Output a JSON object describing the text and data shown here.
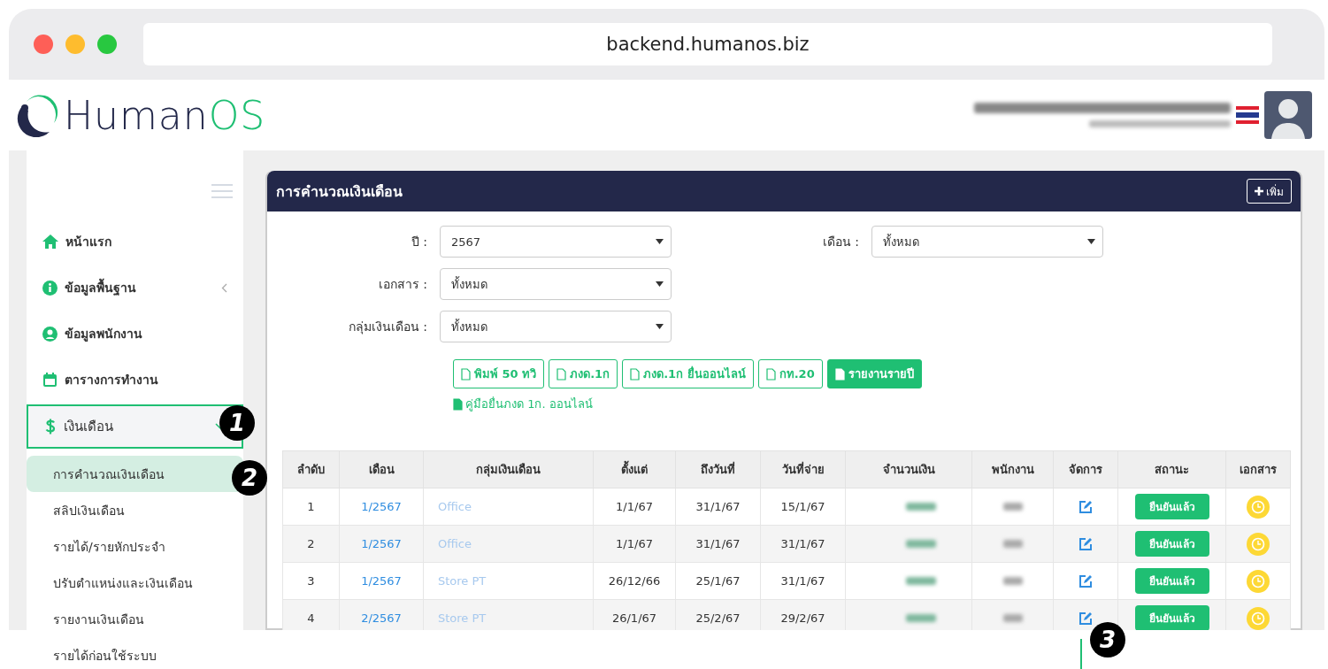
{
  "browser": {
    "address": "backend.humanos.biz"
  },
  "header": {
    "logo_dark": "Human",
    "logo_green": "OS"
  },
  "sidebar": {
    "items": [
      {
        "label": "หน้าแรก",
        "selected": false
      },
      {
        "label": "ข้อมูลพื้นฐาน",
        "selected": false,
        "expanded": false
      },
      {
        "label": "ข้อมูลพนักงาน",
        "selected": false
      },
      {
        "label": "ตารางการทำงาน",
        "selected": false
      },
      {
        "label": "เงินเดือน",
        "selected": true,
        "expanded": true,
        "children": [
          {
            "label": "การคำนวณเงินเดือน",
            "selected": true
          },
          {
            "label": "สลิปเงินเดือน",
            "selected": false
          },
          {
            "label": "รายได้/รายหักประจำ",
            "selected": false
          },
          {
            "label": "ปรับตำแหน่งและเงินเดือน",
            "selected": false
          },
          {
            "label": "รายงานเงินเดือน",
            "selected": false
          },
          {
            "label": "รายได้ก่อนใช้ระบบ",
            "selected": false
          }
        ]
      }
    ]
  },
  "panel": {
    "title": "การคำนวณเงินเดือน",
    "add_button": "เพิ่ม",
    "filters": [
      {
        "label": "ปี :",
        "value": "2567"
      },
      {
        "label": "เดือน :",
        "value": "ทั้งหมด"
      },
      {
        "label": "เอกสาร :",
        "value": "ทั้งหมด"
      },
      {
        "label": "กลุ่มเงินเดือน :",
        "value": "ทั้งหมด"
      }
    ],
    "actions": [
      {
        "label": "พิมพ์ 50 ทวิ",
        "kind": "outline"
      },
      {
        "label": "ภงด.1ก",
        "kind": "outline"
      },
      {
        "label": "ภงด.1ก ยื่นออนไลน์",
        "kind": "outline"
      },
      {
        "label": "กท.20",
        "kind": "outline"
      },
      {
        "label": "รายงานรายปี",
        "kind": "filled"
      }
    ],
    "guide_link": "คู่มือยื่นภงด 1ก. ออนไลน์",
    "table": {
      "columns": [
        "ลำดับ",
        "เดือน",
        "กลุ่มเงินเดือน",
        "ตั้งแต่",
        "ถึงวันที่",
        "วันที่จ่าย",
        "จำนวนเงิน",
        "พนักงาน",
        "จัดการ",
        "สถานะ",
        "เอกสาร"
      ],
      "rows": [
        {
          "no": "1",
          "month": "1/2567",
          "group": "Office",
          "from": "1/1/67",
          "to": "31/1/67",
          "paid": "15/1/67",
          "status": "ยืนยันแล้ว"
        },
        {
          "no": "2",
          "month": "1/2567",
          "group": "Office",
          "from": "1/1/67",
          "to": "31/1/67",
          "paid": "31/1/67",
          "status": "ยืนยันแล้ว"
        },
        {
          "no": "3",
          "month": "1/2567",
          "group": "Store PT",
          "from": "26/12/66",
          "to": "25/1/67",
          "paid": "31/1/67",
          "status": "ยืนยันแล้ว"
        },
        {
          "no": "4",
          "month": "2/2567",
          "group": "Store PT",
          "from": "26/1/67",
          "to": "25/2/67",
          "paid": "29/2/67",
          "status": "ยืนยันแล้ว"
        }
      ]
    }
  },
  "callouts": [
    "1",
    "2",
    "3"
  ]
}
